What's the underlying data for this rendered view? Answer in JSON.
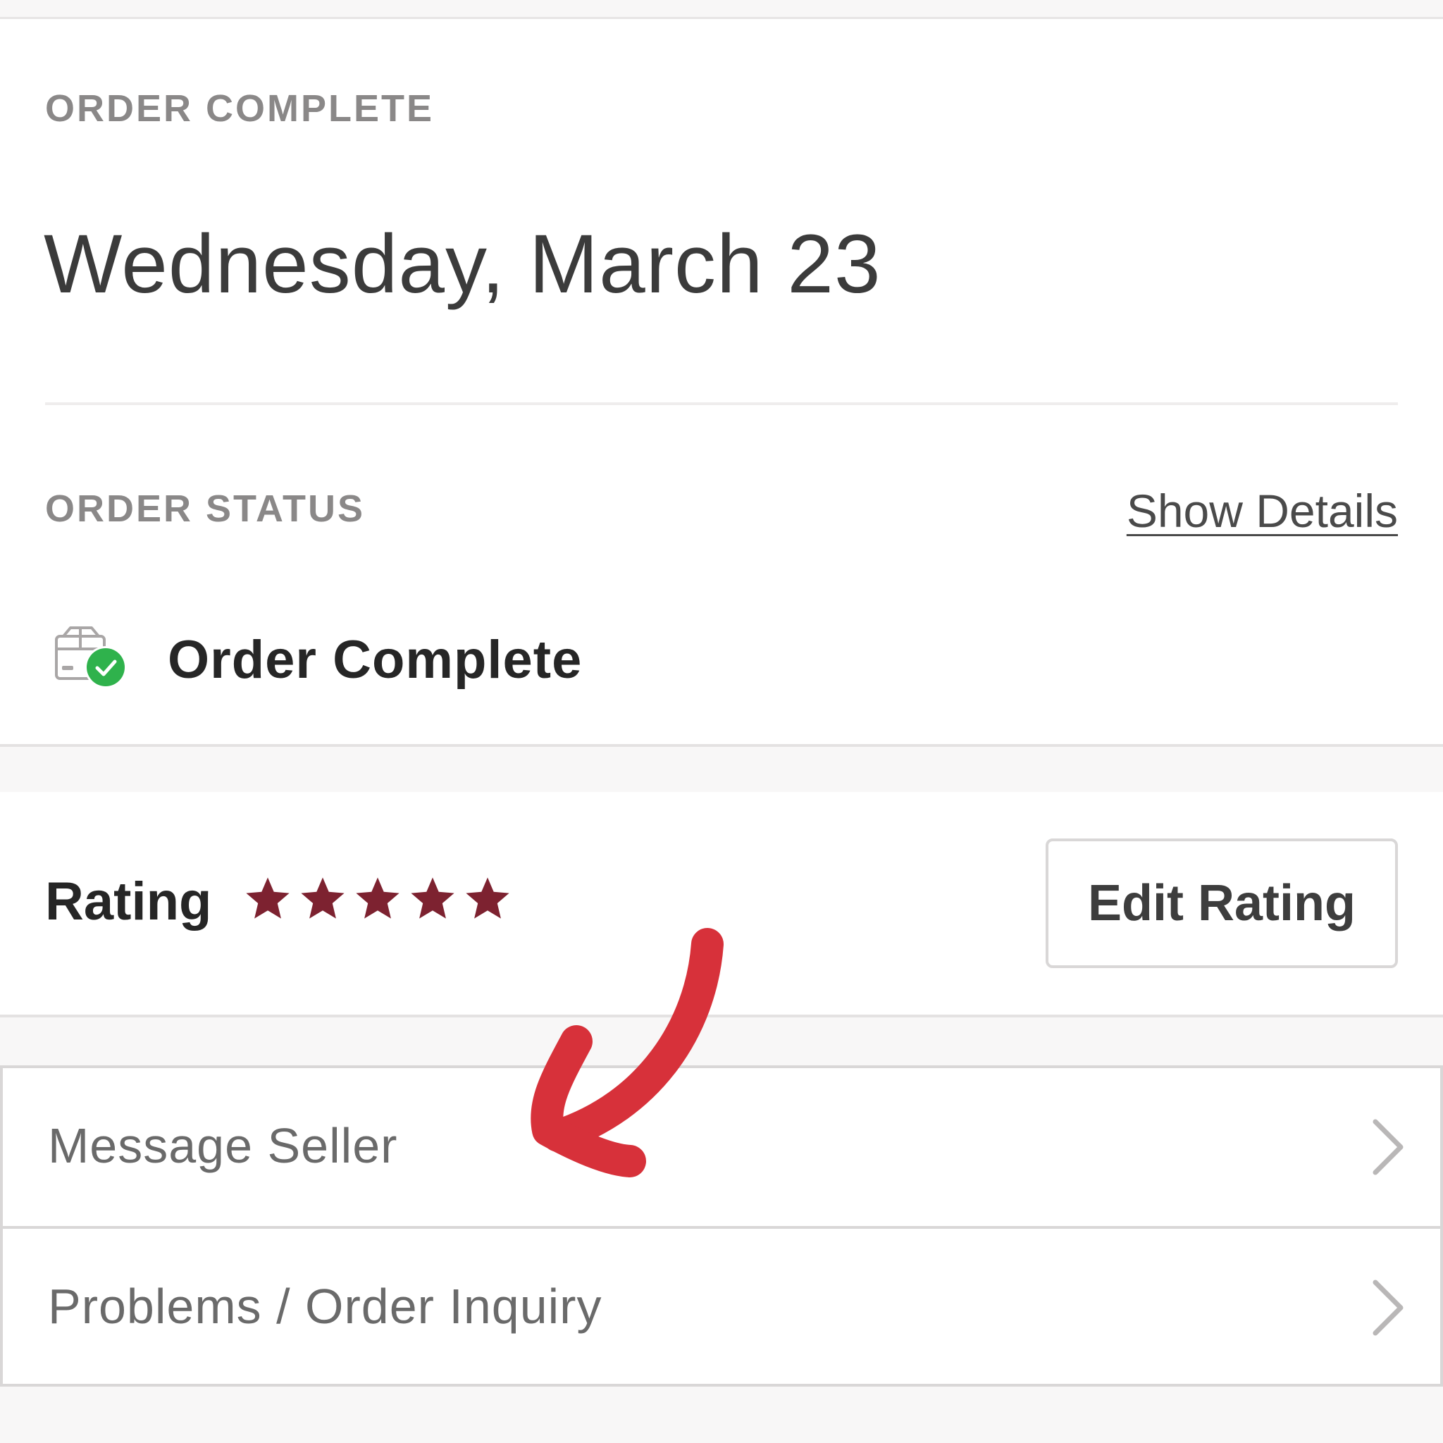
{
  "order_section": {
    "eyebrow": "ORDER COMPLETE",
    "date": "Wednesday, March 23"
  },
  "status_section": {
    "eyebrow": "ORDER STATUS",
    "show_details_link": "Show Details",
    "status_icon": "box-check-icon",
    "status_text": "Order Complete"
  },
  "rating_section": {
    "label": "Rating",
    "stars_filled": 5,
    "stars_total": 5,
    "edit_button": "Edit Rating"
  },
  "actions": [
    {
      "label": "Message Seller",
      "icon": "chevron-right-icon"
    },
    {
      "label": "Problems / Order Inquiry",
      "icon": "chevron-right-icon"
    }
  ],
  "annotation": {
    "type": "hand-drawn-arrow",
    "points_to": "Message Seller"
  },
  "colors": {
    "star": "#7d2230",
    "annotation_arrow": "#d7313a",
    "success": "#2fb24c",
    "eyebrow_text": "#8a8888"
  }
}
